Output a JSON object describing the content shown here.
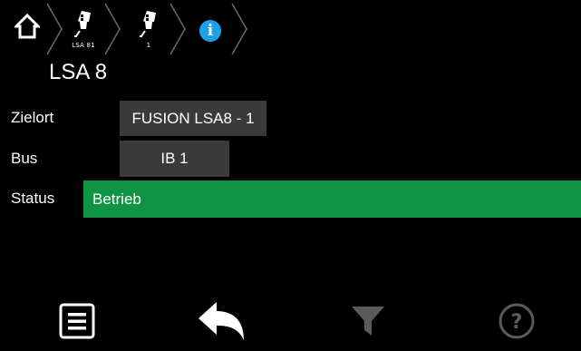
{
  "breadcrumb": {
    "items": [
      {
        "icon": "home-icon",
        "label": ""
      },
      {
        "icon": "device-icon",
        "label": "LSA 81"
      },
      {
        "icon": "device-icon",
        "label": "1"
      },
      {
        "icon": "info-icon",
        "label": "",
        "glyph": "i"
      }
    ]
  },
  "page": {
    "title": "LSA 8"
  },
  "details": {
    "zielort_label": "Zielort",
    "zielort_value": "FUSION LSA8 - 1",
    "bus_label": "Bus",
    "bus_value": "IB 1",
    "status_label": "Status",
    "status_value": "Betrieb"
  },
  "colors": {
    "status_ok": "#0f9444",
    "info": "#1ea0e8",
    "field_bg": "#3a3a3a",
    "disabled": "#5a5a5a"
  },
  "toolbar": {
    "buttons": [
      {
        "icon": "menu-icon",
        "enabled": true
      },
      {
        "icon": "back-arrow-icon",
        "enabled": true
      },
      {
        "icon": "filter-icon",
        "enabled": false
      },
      {
        "icon": "help-icon",
        "enabled": false,
        "glyph": "?"
      }
    ]
  }
}
